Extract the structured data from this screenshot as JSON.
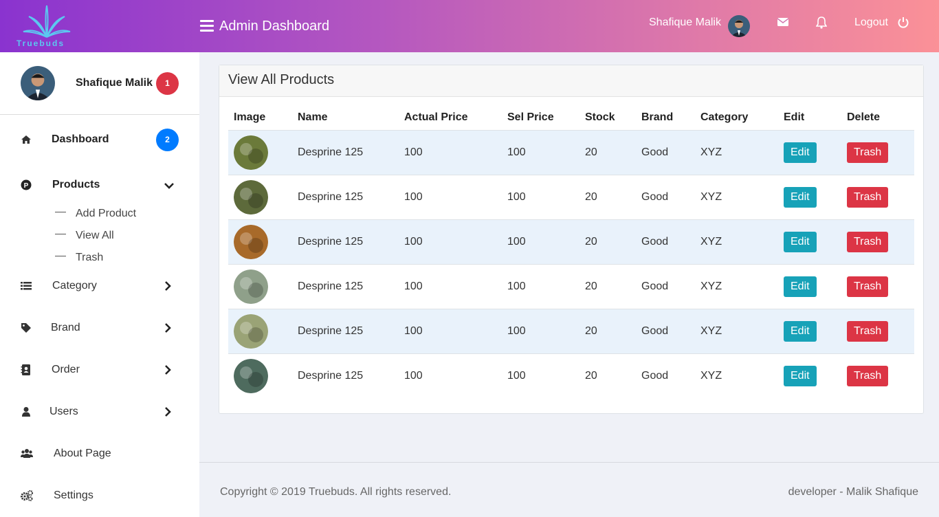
{
  "brand": {
    "name": "Truebuds"
  },
  "topbar": {
    "title": "Admin Dashboard",
    "user_name": "Shafique Malik",
    "logout_label": "Logout"
  },
  "sidebar": {
    "user_name": "Shafique Malik",
    "notification_count": "1",
    "items": [
      {
        "label": "Dashboard",
        "icon": "home-icon",
        "badge": "2"
      },
      {
        "label": "Products",
        "icon": "p-circle-icon"
      },
      {
        "label": "Category",
        "icon": "list-icon"
      },
      {
        "label": "Brand",
        "icon": "tag-icon"
      },
      {
        "label": "Order",
        "icon": "address-book-icon"
      },
      {
        "label": "Users",
        "icon": "user-icon"
      },
      {
        "label": "About Page",
        "icon": "users-icon"
      },
      {
        "label": "Settings",
        "icon": "cogs-icon"
      }
    ],
    "products_submenu": [
      "Add Product",
      "View All",
      "Trash"
    ]
  },
  "card": {
    "title": "View All Products",
    "columns": [
      "Image",
      "Name",
      "Actual Price",
      "Sel Price",
      "Stock",
      "Brand",
      "Category",
      "Edit",
      "Delete"
    ],
    "rows": [
      {
        "name": "Desprine 125",
        "actual_price": "100",
        "sel_price": "100",
        "stock": "20",
        "brand": "Good",
        "category": "XYZ",
        "edit": "Edit",
        "delete": "Trash",
        "img_color": "#6b7a3a"
      },
      {
        "name": "Desprine 125",
        "actual_price": "100",
        "sel_price": "100",
        "stock": "20",
        "brand": "Good",
        "category": "XYZ",
        "edit": "Edit",
        "delete": "Trash",
        "img_color": "#5d6a3b"
      },
      {
        "name": "Desprine 125",
        "actual_price": "100",
        "sel_price": "100",
        "stock": "20",
        "brand": "Good",
        "category": "XYZ",
        "edit": "Edit",
        "delete": "Trash",
        "img_color": "#a86a2a"
      },
      {
        "name": "Desprine 125",
        "actual_price": "100",
        "sel_price": "100",
        "stock": "20",
        "brand": "Good",
        "category": "XYZ",
        "edit": "Edit",
        "delete": "Trash",
        "img_color": "#8fa08a"
      },
      {
        "name": "Desprine 125",
        "actual_price": "100",
        "sel_price": "100",
        "stock": "20",
        "brand": "Good",
        "category": "XYZ",
        "edit": "Edit",
        "delete": "Trash",
        "img_color": "#9aa376"
      },
      {
        "name": "Desprine 125",
        "actual_price": "100",
        "sel_price": "100",
        "stock": "20",
        "brand": "Good",
        "category": "XYZ",
        "edit": "Edit",
        "delete": "Trash",
        "img_color": "#4e6b5e"
      }
    ]
  },
  "footer": {
    "copyright": "Copyright © 2019 Truebuds. All rights reserved.",
    "developer": "developer - Malik Shafique"
  }
}
